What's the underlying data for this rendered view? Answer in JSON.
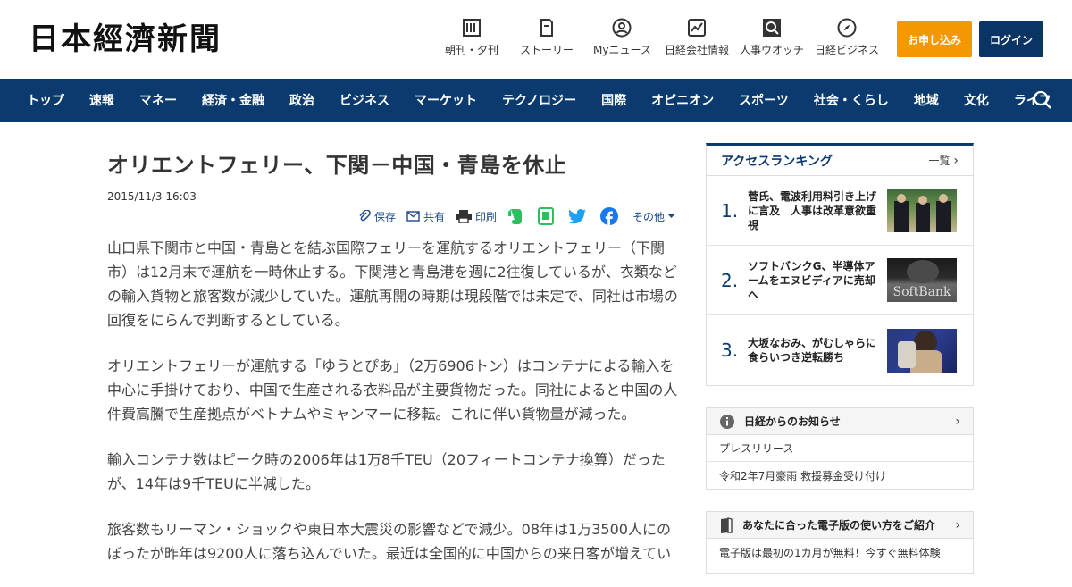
{
  "header": {
    "logo": "日本經濟新聞",
    "nav": [
      {
        "label": "朝刊・夕刊",
        "icon": "newspaper-icon"
      },
      {
        "label": "ストーリー",
        "icon": "document-icon"
      },
      {
        "label": "Myニュース",
        "icon": "user-icon"
      },
      {
        "label": "日経会社情報",
        "icon": "chart-icon"
      },
      {
        "label": "人事ウオッチ",
        "icon": "search-person-icon"
      },
      {
        "label": "日経ビジネス",
        "icon": "compass-icon"
      }
    ],
    "apply_label": "お申し込み",
    "login_label": "ログイン"
  },
  "navbar": {
    "items": [
      "トップ",
      "速報",
      "マネー",
      "経済・金融",
      "政治",
      "ビジネス",
      "マーケット",
      "テクノロジー",
      "国際",
      "オピニオン",
      "スポーツ",
      "社会・くらし",
      "地域",
      "文化",
      "ライフ"
    ]
  },
  "article": {
    "title": "オリエントフェリー、下関－中国・青島を休止",
    "date": "2015/11/3 16:03",
    "tools": {
      "save": "保存",
      "share": "共有",
      "print": "印刷",
      "other": "その他"
    },
    "paragraphs": [
      "山口県下関市と中国・青島とを結ぶ国際フェリーを運航するオリエントフェリー（下関市）は12月末で運航を一時休止する。下関港と青島港を週に2往復しているが、衣類などの輸入貨物と旅客数が減少していた。運航再開の時期は現段階では未定で、同社は市場の回復をにらんで判断するとしている。",
      "オリエントフェリーが運航する「ゆうとぴあ」（2万6906トン）はコンテナによる輸入を中心に手掛けており、中国で生産される衣料品が主要貨物だった。同社によると中国の人件費高騰で生産拠点がベトナムやミャンマーに移転。これに伴い貨物量が減った。",
      "輸入コンテナ数はピーク時の2006年は1万8千TEU（20フィートコンテナ換算）だったが、14年は9千TEUに半減した。",
      "旅客数もリーマン・ショックや東日本大震災の影響などで減少。08年は1万3500人にのぼったが昨年は9200人に落ち込んでいた。最近は全国的に中国からの来日客が増えてい"
    ]
  },
  "ranking": {
    "title": "アクセスランキング",
    "more": "一覧",
    "items": [
      {
        "num": "1.",
        "text": "菅氏、電波利用料引き上げに言及　人事は改革意欲重視"
      },
      {
        "num": "2.",
        "text": "ソフトバンクG、半導体アームをエヌビディアに売却へ"
      },
      {
        "num": "3.",
        "text": "大坂なおみ、がむしゃらに食らいつき逆転勝ち"
      }
    ],
    "thumb2_text": "SoftBank"
  },
  "notice": {
    "title": "日経からのお知らせ",
    "rows": [
      "プレスリリース",
      "令和2年7月豪雨 救援募金受け付け"
    ]
  },
  "guide": {
    "title": "あなたに合った電子版の使い方をご紹介",
    "row": "電子版は最初の1カ月が無料！今すぐ無料体験"
  },
  "colors": {
    "nav_bg": "#0a3a6e",
    "apply_bg": "#f39800",
    "login_bg": "#0a3464"
  }
}
